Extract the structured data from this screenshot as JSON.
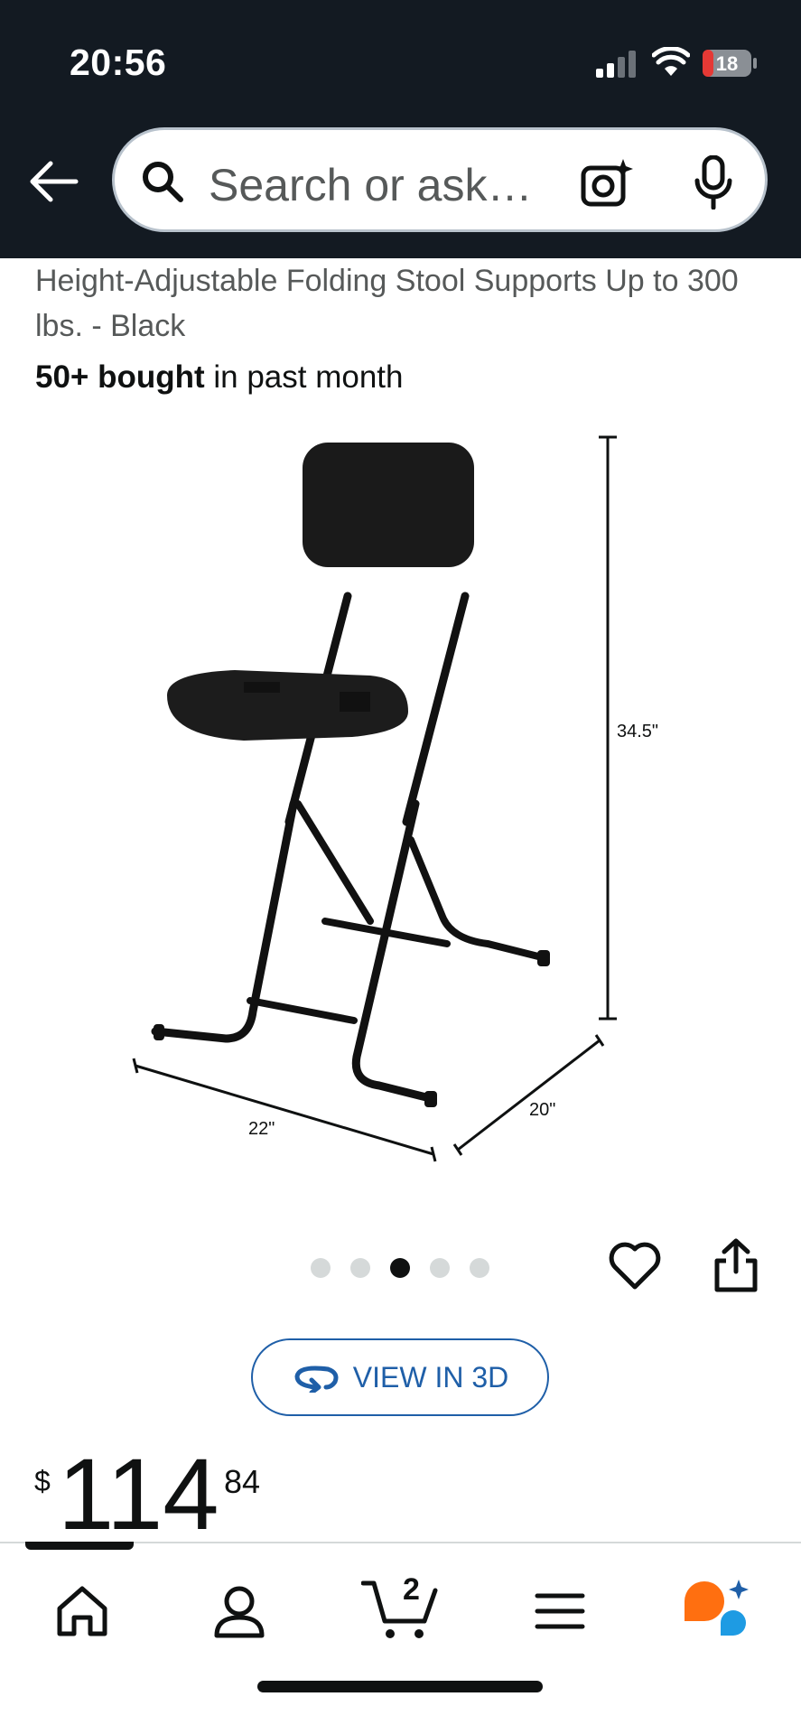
{
  "status_bar": {
    "time": "20:56",
    "battery": "18"
  },
  "search": {
    "placeholder": "Search or ask…"
  },
  "product": {
    "title": "Height-Adjustable Folding Stool Supports Up to 300 lbs. - Black",
    "bought_bold": "50+ bought",
    "bought_rest": " in past month",
    "dimensions": {
      "height": "34.5\"",
      "width": "22\"",
      "depth": "20\""
    },
    "carousel": {
      "total": 5,
      "active": 3
    },
    "view3d_label": "VIEW IN 3D",
    "price": {
      "currency": "$",
      "whole": "114",
      "fraction": "84"
    }
  },
  "nav": {
    "cart_count": "2"
  },
  "icons": [
    "back-arrow-icon",
    "search-icon",
    "camera-icon",
    "mic-icon",
    "heart-icon",
    "share-icon",
    "view-3d-icon",
    "home-icon",
    "account-icon",
    "cart-icon",
    "menu-icon",
    "rufus-icon"
  ]
}
